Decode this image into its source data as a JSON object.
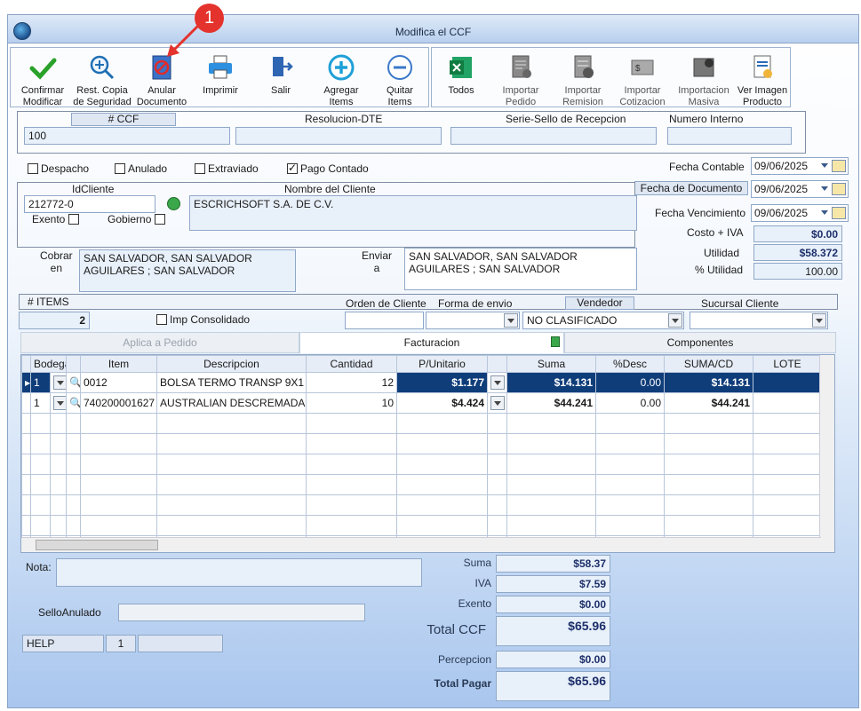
{
  "window": {
    "title": "Modifica el CCF"
  },
  "annotation": {
    "badge_number": "1"
  },
  "toolbar": {
    "confirm": [
      "Confirmar",
      "Modificar"
    ],
    "backup": [
      "Rest. Copia",
      "de Seguridad"
    ],
    "void": [
      "Anular",
      "Documento"
    ],
    "print": "Imprimir",
    "exit": "Salir",
    "add_items": [
      "Agregar",
      "Items"
    ],
    "remove_items": [
      "Quitar",
      "Items"
    ],
    "all": "Todos",
    "import_order": [
      "Importar",
      "Pedido"
    ],
    "import_remision": [
      "Importar",
      "Remision"
    ],
    "import_quote": [
      "Importar",
      "Cotizacion"
    ],
    "mass_import": [
      "Importacion",
      "Masiva"
    ],
    "view_image": [
      "Ver Imagen",
      "Producto"
    ]
  },
  "doc": {
    "ccf_label": "# CCF",
    "ccf_value": "100",
    "resolucion_label": "Resolucion-DTE",
    "serie_label": "Serie-Sello de Recepcion",
    "numero_interno_label": "Numero Interno"
  },
  "flags": {
    "despacho": "Despacho",
    "anulado": "Anulado",
    "extraviado": "Extraviado",
    "pago_contado": "Pago Contado"
  },
  "dates": {
    "fecha_contable_label": "Fecha Contable",
    "fecha_contable": "09/06/2025",
    "fecha_documento_label": "Fecha de  Documento",
    "fecha_documento": "09/06/2025",
    "fecha_vencimiento_label": "Fecha Vencimiento",
    "fecha_vencimiento": "09/06/2025"
  },
  "cliente": {
    "id_label": "IdCliente",
    "id_value": "212772-0",
    "nombre_label": "Nombre del Cliente",
    "nombre_value": "ESCRICHSOFT S.A. DE C.V.",
    "exento_label": "Exento",
    "gobierno_label": "Gobierno"
  },
  "costs": {
    "costo_iva_label": "Costo + IVA",
    "costo_iva": "$0.00",
    "utilidad_label": "Utilidad",
    "utilidad": "$58.372",
    "pct_utilidad_label": "% Utilidad",
    "pct_utilidad": "100.00"
  },
  "address": {
    "cobrar_label": [
      "Cobrar",
      "en"
    ],
    "cobrar_lines": [
      "SAN SALVADOR, SAN SALVADOR",
      "AGUILARES ; SAN SALVADOR"
    ],
    "enviar_label": [
      "Enviar",
      "a"
    ],
    "enviar_lines": [
      "SAN SALVADOR, SAN SALVADOR",
      "AGUILARES ; SAN SALVADOR"
    ]
  },
  "order": {
    "items_label": "# ITEMS",
    "items_count": "2",
    "imp_consolidado_label": "Imp Consolidado",
    "orden_cliente_label": "Orden de Cliente",
    "forma_envio_label": "Forma de envio",
    "vendedor_label": "Vendedor",
    "vendedor_value": "NO CLASIFICADO",
    "sucursal_label": "Sucursal Cliente"
  },
  "tabs": {
    "aplica": "Aplica a Pedido",
    "facturacion": "Facturacion",
    "componentes": "Componentes"
  },
  "grid": {
    "headers": [
      "Bodega",
      "",
      "Item",
      "Descripcion",
      "Cantidad",
      "P/Unitario",
      "",
      "Suma",
      "%Desc",
      "SUMA/CD",
      "LOTE"
    ],
    "rows": [
      {
        "bodega": "1",
        "item": "0012",
        "desc": "BOLSA TERMO TRANSP 9X1",
        "cantidad": "12",
        "punit": "$1.177",
        "suma": "$14.131",
        "desc_pct": "0.00",
        "suma_cd": "$14.131"
      },
      {
        "bodega": "1",
        "item": "740200001627",
        "desc": "AUSTRALIAN DESCREMADA",
        "cantidad": "10",
        "punit": "$4.424",
        "suma": "$44.241",
        "desc_pct": "0.00",
        "suma_cd": "$44.241"
      }
    ]
  },
  "footer": {
    "nota_label": "Nota:",
    "sello_anulado_label": "SelloAnulado",
    "help_label": "HELP",
    "help_num": "1",
    "suma_label": "Suma",
    "suma": "$58.37",
    "iva_label": "IVA",
    "iva": "$7.59",
    "exento_label": "Exento",
    "exento": "$0.00",
    "total_ccf_label": "Total CCF",
    "total_ccf": "$65.96",
    "percepcion_label": "Percepcion",
    "percepcion": "$0.00",
    "total_pagar_label": "Total Pagar",
    "total_pagar": "$65.96"
  }
}
